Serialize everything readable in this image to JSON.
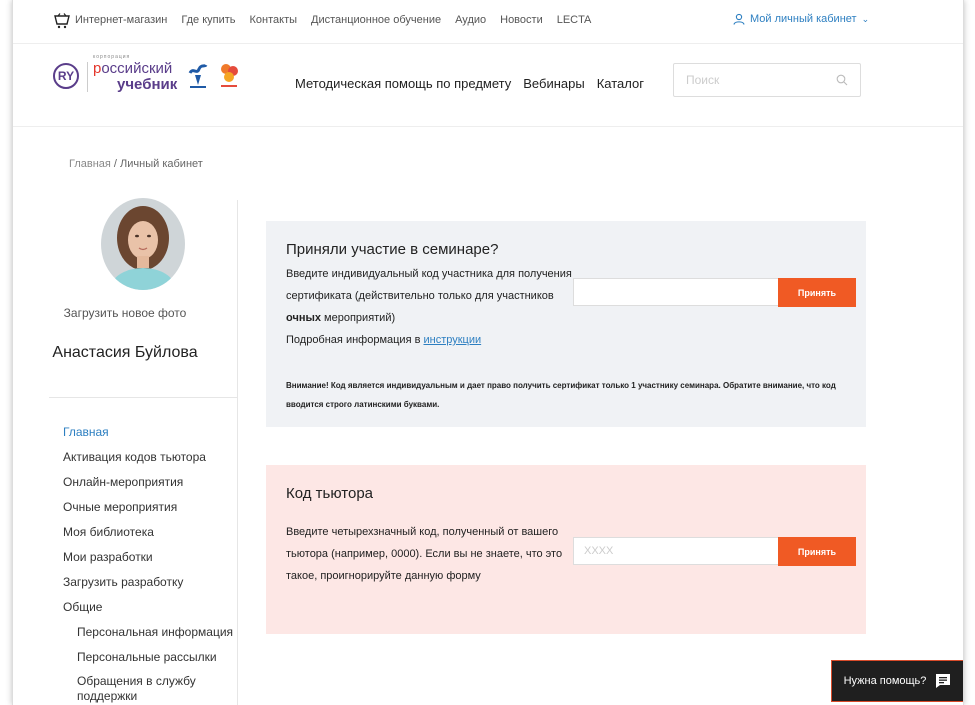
{
  "topbar": {
    "links": [
      "Интернет-магазин",
      "Где купить",
      "Контакты",
      "Дистанционное обучение",
      "Аудио",
      "Новости",
      "LECTA"
    ],
    "account_label": "Мой личный кабинет"
  },
  "header": {
    "logo": {
      "circle_text": "RY",
      "small_text": "корпорация",
      "line1_first": "р",
      "line1_rest": "оссийский",
      "line2": "учебник"
    },
    "nav": [
      "Методическая помощь по предмету",
      "Вебинары",
      "Каталог"
    ],
    "search_placeholder": "Поиск"
  },
  "breadcrumb": {
    "home": "Главная",
    "separator": " / ",
    "current": "Личный кабинет"
  },
  "profile": {
    "upload_photo": "Загрузить новое фото",
    "name": "Анастасия Буйлова"
  },
  "menu": [
    "Главная",
    "Активация кодов тьютора",
    "Онлайн-мероприятия",
    "Очные мероприятия",
    "Моя библиотека",
    "Мои разработки",
    "Загрузить разработку",
    "Общие",
    "Персональная информация",
    "Персональные рассылки",
    "Обращения в службу поддержки"
  ],
  "seminar": {
    "title": "Приняли участие в семинаре?",
    "text1": "Введите индивидуальный код участника для получения сертификата (действительно только для участников ",
    "text_bold": "очных",
    "text2": " мероприятий)",
    "info_prefix": "Подробная информация в ",
    "info_link": "инструкции",
    "input_value": "",
    "button": "Принять",
    "warning": "Внимание! Код является индивидуальным и дает право получить сертификат только 1 участнику семинара. Обратите внимание, что код вводится строго латинскими буквами."
  },
  "tutor": {
    "title": "Код тьютора",
    "text": "Введите четырехзначный код, полученный от вашего тьютора (например, 0000). Если вы не знаете, что это такое, проигнорируйте данную форму",
    "input_placeholder": "XXXX",
    "button": "Принять"
  },
  "help": {
    "label": "Нужна помощь?"
  },
  "colors": {
    "accent": "#f05a24",
    "link": "#2d7fc1",
    "brand_purple": "#5a3d8a",
    "seminar_bg": "#f0f2f5",
    "tutor_bg": "#fde7e5"
  }
}
